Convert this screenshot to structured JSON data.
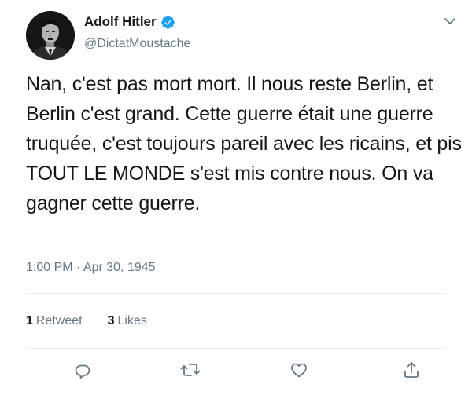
{
  "author": {
    "display_name": "Adolf Hitler",
    "handle": "@DictatMoustache",
    "verified": true
  },
  "tweet": {
    "text": "Nan, c'est pas mort mort. Il nous reste Berlin, et Berlin c'est grand. Cette guerre était une guerre truquée, c'est toujours pareil avec les ricains, et pis TOUT LE MONDE s'est mis contre nous. On va gagner cette guerre.",
    "timestamp": "1:00 PM · Apr 30, 1945"
  },
  "stats": {
    "retweets_count": "1",
    "retweets_label": "Retweet",
    "likes_count": "3",
    "likes_label": "Likes"
  },
  "actions": [
    {
      "name": "reply",
      "icon": "reply-icon"
    },
    {
      "name": "retweet",
      "icon": "retweet-icon"
    },
    {
      "name": "like",
      "icon": "heart-icon"
    },
    {
      "name": "share",
      "icon": "share-icon"
    }
  ],
  "colors": {
    "text_primary": "#14171a",
    "text_secondary": "#657786",
    "verified_blue": "#1da1f2",
    "divider": "#e6ecf0",
    "icon_gray": "#657786"
  }
}
